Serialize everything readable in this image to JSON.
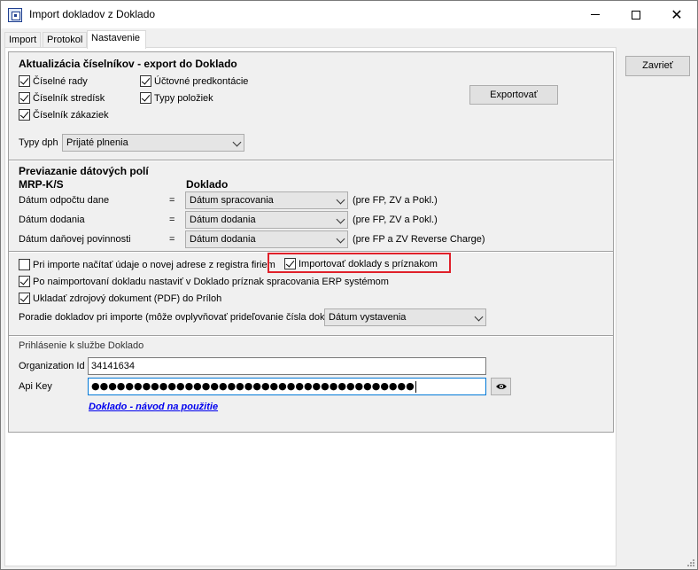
{
  "window": {
    "title": "Import dokladov z Doklado",
    "icon": "app-window-icon"
  },
  "tabs": [
    {
      "label": "Import",
      "active": false
    },
    {
      "label": "Protokol",
      "active": false
    },
    {
      "label": "Nastavenie",
      "active": true
    }
  ],
  "close_button": {
    "label": "Zavrieť"
  },
  "codebooks": {
    "heading": "Aktualizácia číselníkov - export do Doklado",
    "checkboxes": [
      {
        "label": "Číselné rady",
        "checked": true
      },
      {
        "label": "Číselník stredísk",
        "checked": true
      },
      {
        "label": "Číselník zákaziek",
        "checked": true
      },
      {
        "label": "Účtovné predkontácie",
        "checked": true
      },
      {
        "label": "Typy položiek",
        "checked": true
      }
    ],
    "export_button": "Exportovať",
    "vat_label": "Typy dph",
    "vat_value": "Prijaté plnenia"
  },
  "mapping": {
    "heading": "Previazanie dátových polí",
    "col_left": "MRP-K/S",
    "col_right": "Doklado",
    "rows": [
      {
        "label": "Dátum odpočtu dane",
        "eq": "=",
        "value": "Dátum spracovania",
        "note": "(pre FP, ZV a Pokl.)"
      },
      {
        "label": "Dátum dodania",
        "eq": "=",
        "value": "Dátum dodania",
        "note": "(pre FP, ZV a Pokl.)"
      },
      {
        "label": "Dátum daňovej povinnosti",
        "eq": "=",
        "value": "Dátum dodania",
        "note": "(pre FP a ZV Reverse Charge)"
      }
    ]
  },
  "import_options": {
    "read_address": {
      "label": "Pri importe načítať údaje o novej adrese z registra firiem",
      "checked": false
    },
    "import_flagged": {
      "label": "Importovať doklady s príznakom",
      "checked": true
    },
    "set_processed": {
      "label": "Po naimportovaní dokladu nastaviť v Doklado príznak spracovania ERP systémom",
      "checked": true
    },
    "save_pdf": {
      "label": "Ukladať zdrojový dokument (PDF) do Príloh",
      "checked": true
    },
    "order_label": "Poradie dokladov pri importe (môže ovplyvňovať prideľovanie čísla dokladu)",
    "order_value": "Dátum vystavenia"
  },
  "login": {
    "heading": "Prihlásenie k službe Doklado",
    "org_label": "Organization Id",
    "org_value": "34141634",
    "api_label": "Api Key",
    "api_value": "●●●●●●●●●●●●●●●●●●●●●●●●●●●●●●●●●●●●●●",
    "help_link": "Doklado - návod na použitie"
  },
  "colors": {
    "highlight": "#e0202a",
    "link": "#0000ee",
    "focus": "#0078d7"
  }
}
